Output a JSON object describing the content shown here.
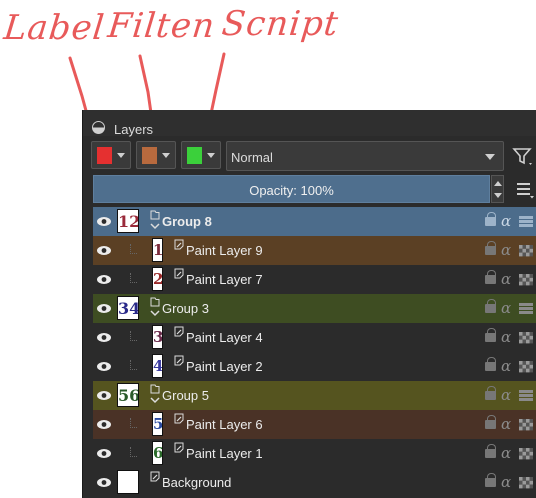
{
  "annotations": {
    "label": "Label",
    "filter": "Filten",
    "script": "Scnipt"
  },
  "docker": {
    "title": "Layers",
    "label_color": "#e53030",
    "filter_color": "#b86a3e",
    "script_color": "#3bd03b",
    "blend_mode": "Normal",
    "opacity_label": "Opacity:  100%"
  },
  "layers": [
    {
      "name": "Group 8",
      "thumb": "12",
      "type": "group",
      "indent": 0,
      "selected": true,
      "color": "#4c6c8b"
    },
    {
      "name": "Paint Layer 9",
      "thumb": "1",
      "type": "paint",
      "indent": 1,
      "selected": false,
      "color": "#5b4024"
    },
    {
      "name": "Paint Layer 7",
      "thumb": "2",
      "type": "paint",
      "indent": 1,
      "selected": false,
      "color": "#2b2b2b"
    },
    {
      "name": "Group 3",
      "thumb": "34",
      "type": "group",
      "indent": 0,
      "selected": false,
      "color": "#3e4d22"
    },
    {
      "name": "Paint Layer 4",
      "thumb": "3",
      "type": "paint",
      "indent": 1,
      "selected": false,
      "color": "#2b2b2b"
    },
    {
      "name": "Paint Layer 2",
      "thumb": "4",
      "type": "paint",
      "indent": 1,
      "selected": false,
      "color": "#2b2b2b"
    },
    {
      "name": "Group 5",
      "thumb": "56",
      "type": "group",
      "indent": 0,
      "selected": false,
      "color": "#55541f"
    },
    {
      "name": "Paint Layer 6",
      "thumb": "5",
      "type": "paint",
      "indent": 1,
      "selected": false,
      "color": "#4a3226"
    },
    {
      "name": "Paint Layer 1",
      "thumb": "6",
      "type": "paint",
      "indent": 1,
      "selected": false,
      "color": "#2b2b2b"
    },
    {
      "name": "Background",
      "thumb": "",
      "type": "background",
      "indent": 0,
      "selected": false,
      "color": "#2b2b2b"
    }
  ]
}
